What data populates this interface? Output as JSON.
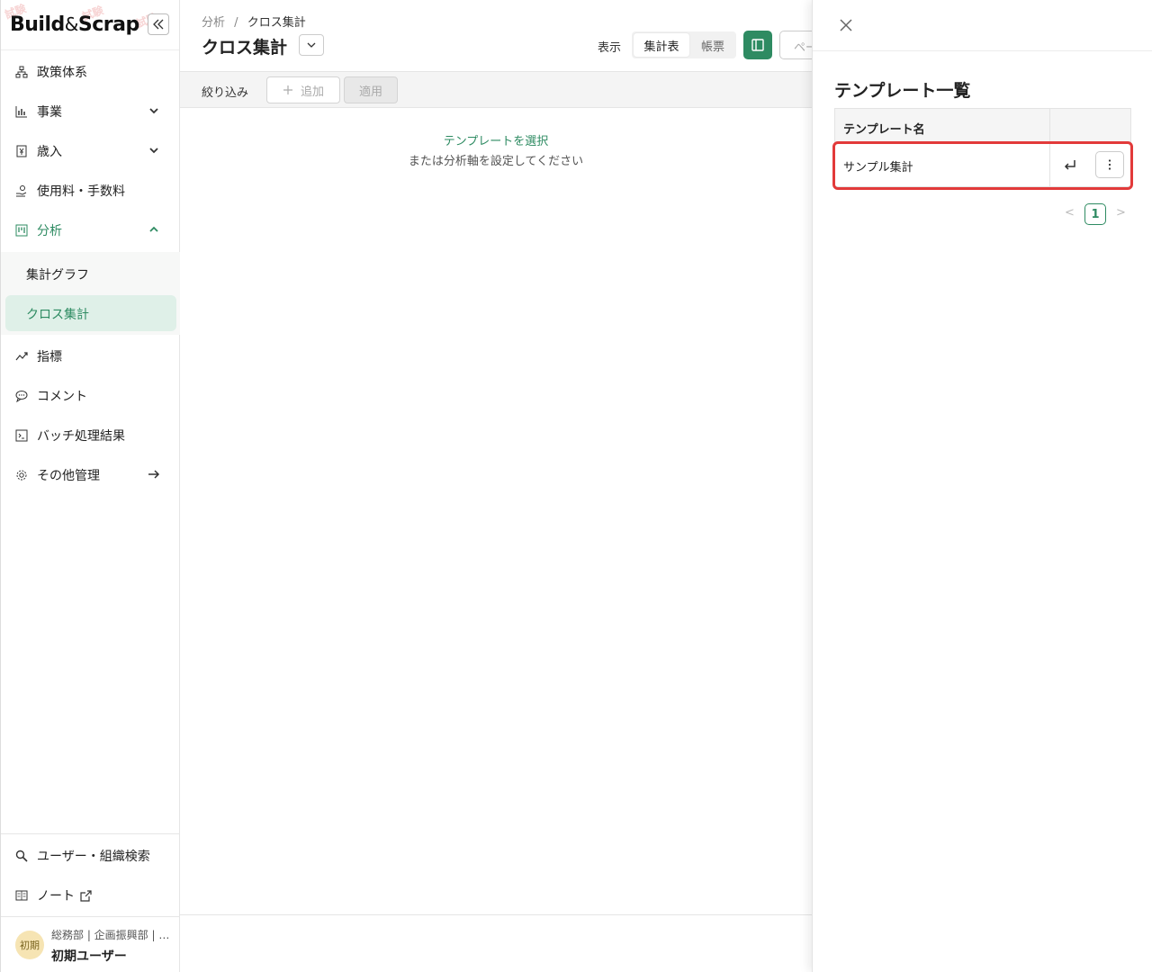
{
  "sidebar": {
    "logo_left": "Build",
    "logo_amp": "&",
    "logo_right": "Scrap",
    "stamp_text": "試験",
    "nav": [
      {
        "label": "政策体系",
        "icon": "org-chart-icon"
      },
      {
        "label": "事業",
        "icon": "bar-chart-icon"
      },
      {
        "label": "歳入",
        "icon": "yen-receipt-icon"
      },
      {
        "label": "使用料・手数料",
        "icon": "hand-coin-icon"
      },
      {
        "label": "分析",
        "icon": "kanban-icon"
      },
      {
        "label": "指標",
        "icon": "trend-icon"
      },
      {
        "label": "コメント",
        "icon": "comment-icon"
      },
      {
        "label": "バッチ処理結果",
        "icon": "terminal-icon"
      },
      {
        "label": "その他管理",
        "icon": "gear-icon"
      }
    ],
    "sub_nav": [
      {
        "label": "集計グラフ"
      },
      {
        "label": "クロス集計"
      }
    ],
    "bottom_nav": [
      {
        "label": "ユーザー・組織検索",
        "icon": "search-icon"
      },
      {
        "label": "ノート",
        "icon": "book-icon"
      }
    ],
    "user": {
      "avatar": "初期",
      "org": "総務部 | 企画振興部 | …",
      "name": "初期ユーザー"
    }
  },
  "main": {
    "breadcrumb_parent": "分析",
    "breadcrumb_sep": "/",
    "breadcrumb_current": "クロス集計",
    "title": "クロス集計",
    "view_label": "表示",
    "view_options": [
      "集計表",
      "帳票"
    ],
    "cut_button": "ペー",
    "filter_label": "絞り込み",
    "add_label": "追加",
    "apply_label": "適用",
    "empty_link": "テンプレートを選択",
    "empty_text": "または分析軸を設定してください"
  },
  "drawer": {
    "title": "テンプレート一覧",
    "column_name": "テンプレート名",
    "rows": [
      {
        "name": "サンプル集計"
      }
    ],
    "page_current": "1",
    "page_prev": "<",
    "page_next": ">"
  },
  "colors": {
    "accent": "#2e8b62",
    "active_bg": "#dff0e8",
    "highlight": "#e23a3a"
  }
}
